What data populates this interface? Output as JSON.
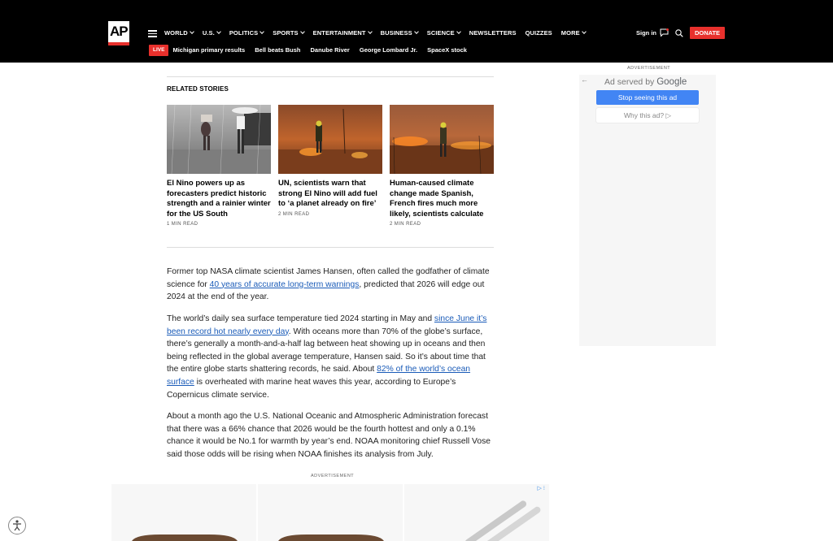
{
  "header": {
    "logo_text": "AP",
    "nav": [
      "WORLD",
      "U.S.",
      "POLITICS",
      "SPORTS",
      "ENTERTAINMENT",
      "BUSINESS",
      "SCIENCE",
      "NEWSLETTERS",
      "QUIZZES",
      "MORE"
    ],
    "nav_has_chevron": [
      true,
      true,
      true,
      true,
      true,
      true,
      true,
      false,
      false,
      true
    ],
    "signin": "Sign in",
    "donate": "DONATE",
    "live_label": "LIVE",
    "trending": [
      "Michigan primary results",
      "Bell beats Bush",
      "Danube River",
      "George Lombard Jr.",
      "SpaceX stock"
    ]
  },
  "related": {
    "title": "RELATED STORIES",
    "stories": [
      {
        "headline": "El Nino powers up as forecasters predict historic strength and a rainier winter for the US South",
        "read_time": "1 MIN READ",
        "image": "rain-street-photo"
      },
      {
        "headline": "UN, scientists warn that strong El Nino will add fuel to ‘a planet already on fire’",
        "read_time": "2 MIN READ",
        "image": "wildfire-firefighter-photo"
      },
      {
        "headline": "Human-caused climate change made Spanish, French fires much more likely, scientists calculate",
        "read_time": "2 MIN READ",
        "image": "wildfire-field-photo"
      }
    ]
  },
  "article": {
    "p1_a": "Former top NASA climate scientist James Hansen, often called the godfather of climate science for ",
    "p1_link": "40 years of accurate long-term warnings",
    "p1_b": ", predicted that 2026 will edge out 2024 at the end of the year.",
    "p2_a": "The world’s daily sea surface temperature tied 2024 starting in May and ",
    "p2_link1": "since June it’s been record hot nearly every day",
    "p2_b": ". With oceans more than 70% of the globe’s surface, there’s generally a month-and-a-half lag between heat showing up in oceans and then being reflected in the global average temperature, Hansen said. So it’s about time that the entire globe starts shattering records, he said. About ",
    "p2_link2": "82% of the world’s ocean surface",
    "p2_c": " is overheated with marine heat waves this year, according to Europe’s Copernicus climate service.",
    "p3": "About a month ago the U.S. National Oceanic and Atmospheric Administration forecast that there was a 66% chance that 2026 would be the fourth hottest and only a 0.1% chance it would be No.1 for warmth by year’s end. NOAA monitoring chief Russell Vose said those odds will be rising when NOAA finishes its analysis from July."
  },
  "side_ad": {
    "label": "ADVERTISEMENT",
    "served_prefix": "Ad served by ",
    "served_brand": "Google",
    "stop_button": "Stop seeing this ad",
    "why_button": "Why this ad? ▷"
  },
  "bottom_ad": {
    "label": "ADVERTISEMENT",
    "adchoices": "▷ ⁝"
  },
  "colors": {
    "brand_red": "#e8302c",
    "link_blue": "#1a5bb8",
    "google_blue": "#4285f4"
  }
}
